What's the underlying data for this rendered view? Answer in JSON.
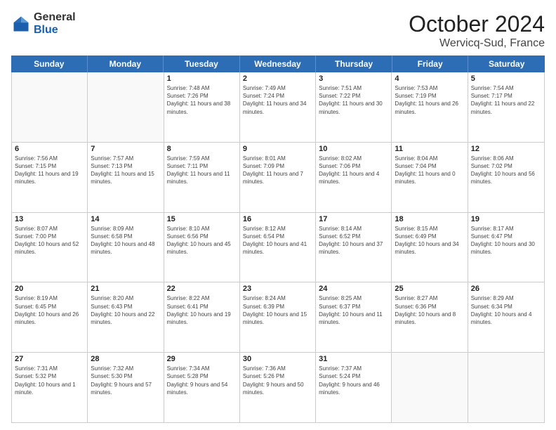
{
  "logo": {
    "general": "General",
    "blue": "Blue"
  },
  "title": "October 2024",
  "subtitle": "Wervicq-Sud, France",
  "header_days": [
    "Sunday",
    "Monday",
    "Tuesday",
    "Wednesday",
    "Thursday",
    "Friday",
    "Saturday"
  ],
  "weeks": [
    [
      {
        "day": "",
        "info": ""
      },
      {
        "day": "",
        "info": ""
      },
      {
        "day": "1",
        "info": "Sunrise: 7:48 AM\nSunset: 7:26 PM\nDaylight: 11 hours and 38 minutes."
      },
      {
        "day": "2",
        "info": "Sunrise: 7:49 AM\nSunset: 7:24 PM\nDaylight: 11 hours and 34 minutes."
      },
      {
        "day": "3",
        "info": "Sunrise: 7:51 AM\nSunset: 7:22 PM\nDaylight: 11 hours and 30 minutes."
      },
      {
        "day": "4",
        "info": "Sunrise: 7:53 AM\nSunset: 7:19 PM\nDaylight: 11 hours and 26 minutes."
      },
      {
        "day": "5",
        "info": "Sunrise: 7:54 AM\nSunset: 7:17 PM\nDaylight: 11 hours and 22 minutes."
      }
    ],
    [
      {
        "day": "6",
        "info": "Sunrise: 7:56 AM\nSunset: 7:15 PM\nDaylight: 11 hours and 19 minutes."
      },
      {
        "day": "7",
        "info": "Sunrise: 7:57 AM\nSunset: 7:13 PM\nDaylight: 11 hours and 15 minutes."
      },
      {
        "day": "8",
        "info": "Sunrise: 7:59 AM\nSunset: 7:11 PM\nDaylight: 11 hours and 11 minutes."
      },
      {
        "day": "9",
        "info": "Sunrise: 8:01 AM\nSunset: 7:09 PM\nDaylight: 11 hours and 7 minutes."
      },
      {
        "day": "10",
        "info": "Sunrise: 8:02 AM\nSunset: 7:06 PM\nDaylight: 11 hours and 4 minutes."
      },
      {
        "day": "11",
        "info": "Sunrise: 8:04 AM\nSunset: 7:04 PM\nDaylight: 11 hours and 0 minutes."
      },
      {
        "day": "12",
        "info": "Sunrise: 8:06 AM\nSunset: 7:02 PM\nDaylight: 10 hours and 56 minutes."
      }
    ],
    [
      {
        "day": "13",
        "info": "Sunrise: 8:07 AM\nSunset: 7:00 PM\nDaylight: 10 hours and 52 minutes."
      },
      {
        "day": "14",
        "info": "Sunrise: 8:09 AM\nSunset: 6:58 PM\nDaylight: 10 hours and 48 minutes."
      },
      {
        "day": "15",
        "info": "Sunrise: 8:10 AM\nSunset: 6:56 PM\nDaylight: 10 hours and 45 minutes."
      },
      {
        "day": "16",
        "info": "Sunrise: 8:12 AM\nSunset: 6:54 PM\nDaylight: 10 hours and 41 minutes."
      },
      {
        "day": "17",
        "info": "Sunrise: 8:14 AM\nSunset: 6:52 PM\nDaylight: 10 hours and 37 minutes."
      },
      {
        "day": "18",
        "info": "Sunrise: 8:15 AM\nSunset: 6:49 PM\nDaylight: 10 hours and 34 minutes."
      },
      {
        "day": "19",
        "info": "Sunrise: 8:17 AM\nSunset: 6:47 PM\nDaylight: 10 hours and 30 minutes."
      }
    ],
    [
      {
        "day": "20",
        "info": "Sunrise: 8:19 AM\nSunset: 6:45 PM\nDaylight: 10 hours and 26 minutes."
      },
      {
        "day": "21",
        "info": "Sunrise: 8:20 AM\nSunset: 6:43 PM\nDaylight: 10 hours and 22 minutes."
      },
      {
        "day": "22",
        "info": "Sunrise: 8:22 AM\nSunset: 6:41 PM\nDaylight: 10 hours and 19 minutes."
      },
      {
        "day": "23",
        "info": "Sunrise: 8:24 AM\nSunset: 6:39 PM\nDaylight: 10 hours and 15 minutes."
      },
      {
        "day": "24",
        "info": "Sunrise: 8:25 AM\nSunset: 6:37 PM\nDaylight: 10 hours and 11 minutes."
      },
      {
        "day": "25",
        "info": "Sunrise: 8:27 AM\nSunset: 6:36 PM\nDaylight: 10 hours and 8 minutes."
      },
      {
        "day": "26",
        "info": "Sunrise: 8:29 AM\nSunset: 6:34 PM\nDaylight: 10 hours and 4 minutes."
      }
    ],
    [
      {
        "day": "27",
        "info": "Sunrise: 7:31 AM\nSunset: 5:32 PM\nDaylight: 10 hours and 1 minute."
      },
      {
        "day": "28",
        "info": "Sunrise: 7:32 AM\nSunset: 5:30 PM\nDaylight: 9 hours and 57 minutes."
      },
      {
        "day": "29",
        "info": "Sunrise: 7:34 AM\nSunset: 5:28 PM\nDaylight: 9 hours and 54 minutes."
      },
      {
        "day": "30",
        "info": "Sunrise: 7:36 AM\nSunset: 5:26 PM\nDaylight: 9 hours and 50 minutes."
      },
      {
        "day": "31",
        "info": "Sunrise: 7:37 AM\nSunset: 5:24 PM\nDaylight: 9 hours and 46 minutes."
      },
      {
        "day": "",
        "info": ""
      },
      {
        "day": "",
        "info": ""
      }
    ]
  ]
}
